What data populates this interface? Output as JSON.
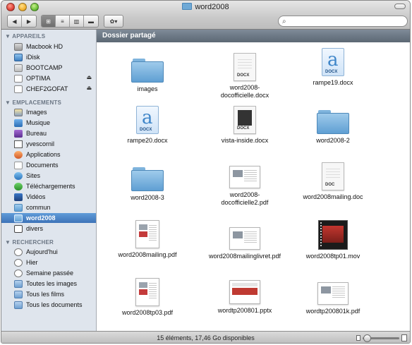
{
  "window": {
    "title": "word2008"
  },
  "toolbar": {
    "back_glyph": "◀",
    "forward_glyph": "▶",
    "view_icons": "⊞",
    "view_list": "≡",
    "view_columns": "▥",
    "view_coverflow": "▬",
    "action_glyph": "✿▾",
    "search_placeholder": ""
  },
  "sidebar": {
    "sections": [
      {
        "title": "▼ APPAREILS"
      },
      {
        "title": "▼ EMPLACEMENTS"
      },
      {
        "title": "▼ RECHERCHER"
      }
    ],
    "devices": [
      {
        "label": "Macbook HD",
        "icon": "hard-drive-icon",
        "eject": false
      },
      {
        "label": "iDisk",
        "icon": "idisk-icon",
        "eject": false
      },
      {
        "label": "BOOTCAMP",
        "icon": "drive-icon",
        "eject": false
      },
      {
        "label": "OPTIMA",
        "icon": "drive-icon",
        "eject": true
      },
      {
        "label": "CHEF2GOFAT",
        "icon": "drive-icon",
        "eject": true
      }
    ],
    "places": [
      {
        "label": "Images",
        "icon": "images-icon"
      },
      {
        "label": "Musique",
        "icon": "music-icon"
      },
      {
        "label": "Bureau",
        "icon": "desktop-icon"
      },
      {
        "label": "yvescornil",
        "icon": "home-icon"
      },
      {
        "label": "Applications",
        "icon": "applications-icon"
      },
      {
        "label": "Documents",
        "icon": "documents-icon"
      },
      {
        "label": "Sites",
        "icon": "sites-icon"
      },
      {
        "label": "Téléchargements",
        "icon": "downloads-icon"
      },
      {
        "label": "Vidéos",
        "icon": "movies-icon"
      },
      {
        "label": "commun",
        "icon": "folder-icon"
      },
      {
        "label": "word2008",
        "icon": "folder-icon",
        "selected": true
      },
      {
        "label": "divers",
        "icon": "folder-icon"
      }
    ],
    "searches": [
      {
        "label": "Aujourd'hui",
        "icon": "clock-icon"
      },
      {
        "label": "Hier",
        "icon": "clock-icon"
      },
      {
        "label": "Semaine passée",
        "icon": "clock-icon"
      },
      {
        "label": "Toutes les images",
        "icon": "smart-folder-icon"
      },
      {
        "label": "Tous les films",
        "icon": "smart-folder-icon"
      },
      {
        "label": "Tous les documents",
        "icon": "smart-folder-icon"
      }
    ],
    "eject_glyph": "⏏"
  },
  "content": {
    "header": "Dossier partagé",
    "files": [
      {
        "name": "images",
        "kind": "folder"
      },
      {
        "name": "word2008-\ndocofficielle.docx",
        "kind": "doc",
        "tag": "DOCX"
      },
      {
        "name": "rampe19.docx",
        "kind": "word",
        "tag": "DOCX"
      },
      {
        "name": "rampe20.docx",
        "kind": "word",
        "tag": "DOCX"
      },
      {
        "name": "vista-inside.docx",
        "kind": "docthumb",
        "tag": "DOCX"
      },
      {
        "name": "word2008-2",
        "kind": "folder"
      },
      {
        "name": "word2008-3",
        "kind": "folder"
      },
      {
        "name": "word2008-\ndocofficielle2.pdf",
        "kind": "wide"
      },
      {
        "name": "word2008mailing.doc",
        "kind": "doc",
        "tag": "DOC"
      },
      {
        "name": "word2008mailing.pdf",
        "kind": "pdf"
      },
      {
        "name": "word2008mailinglivret.pdf",
        "kind": "wide"
      },
      {
        "name": "word2008tp01.mov",
        "kind": "movie"
      },
      {
        "name": "word2008tp03.pdf",
        "kind": "pdf"
      },
      {
        "name": "wordtp200801.pptx",
        "kind": "pptx"
      },
      {
        "name": "wordtp200801k.pdf",
        "kind": "wide"
      }
    ]
  },
  "status": {
    "text": "15 éléments, 17,46 Go disponibles"
  }
}
